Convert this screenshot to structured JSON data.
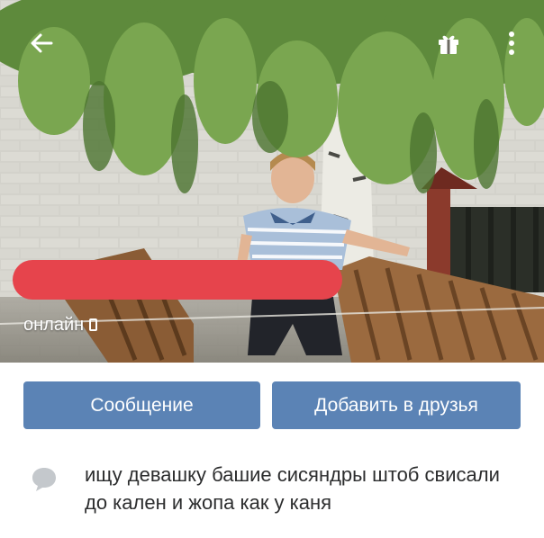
{
  "profile": {
    "status": "онлайн",
    "status_icon": "mobile-phone-icon",
    "about": "ищу девашку башие сисяндры штоб свисали до кален и жопа как у каня"
  },
  "topbar": {
    "back_icon": "arrow-left-icon",
    "gift_icon": "gift-icon",
    "menu_icon": "more-vertical-icon"
  },
  "actions": {
    "message_label": "Сообщение",
    "add_friend_label": "Добавить в друзья"
  },
  "colors": {
    "button": "#5b83b5",
    "redaction": "#e6444c",
    "text": "#2c2d2e"
  }
}
